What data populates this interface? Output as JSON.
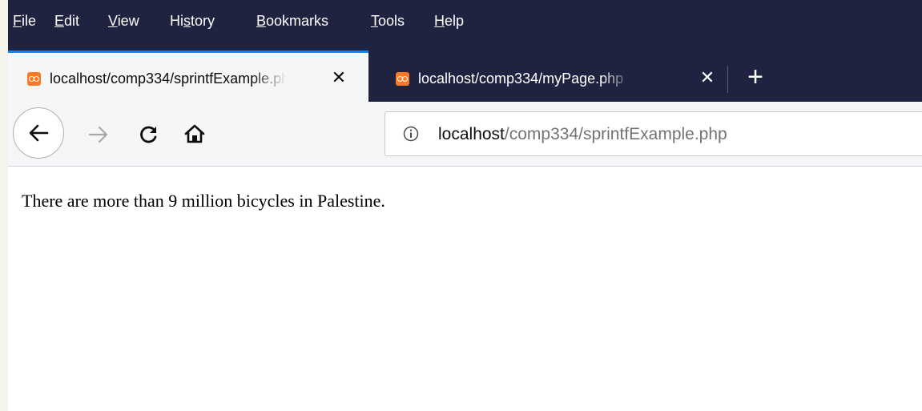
{
  "menubar": {
    "items": [
      {
        "accel": "F",
        "rest": "ile"
      },
      {
        "accel": "E",
        "rest": "dit"
      },
      {
        "accel": "V",
        "rest": "iew"
      },
      {
        "pre": "Hi",
        "accel": "s",
        "rest": "tory"
      },
      {
        "accel": "B",
        "rest": "ookmarks"
      },
      {
        "accel": "T",
        "rest": "ools"
      },
      {
        "accel": "H",
        "rest": "elp"
      }
    ]
  },
  "tabs": [
    {
      "title": "localhost/comp334/sprintfExample.php",
      "icon": "xampp-favicon-icon",
      "active": true
    },
    {
      "title": "localhost/comp334/myPage.php",
      "icon": "xampp-favicon-icon",
      "active": false
    }
  ],
  "toolbar": {
    "new_tab_label": "+",
    "close_label": "✕"
  },
  "urlbar": {
    "host": "localhost",
    "path": "/comp334/sprintfExample.php",
    "icon": "info-icon"
  },
  "page": {
    "text": "There are more than 9 million bicycles in Palestine."
  },
  "colors": {
    "chrome_dark": "#202340",
    "active_tab": "#f5f6f7",
    "tab_accent": "#0a84ff",
    "favicon": "#fb7a24"
  }
}
